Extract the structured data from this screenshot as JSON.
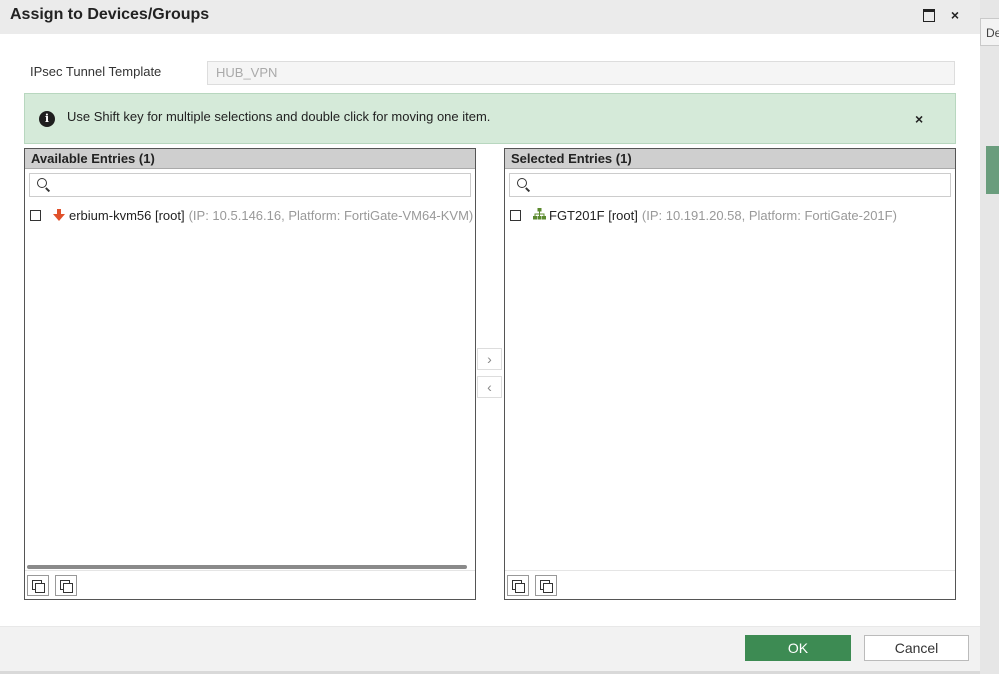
{
  "background": {
    "tab_fragment": "De"
  },
  "dialog": {
    "title": "Assign to Devices/Groups",
    "maximize_icon": "window-maximize",
    "close_glyph": "×"
  },
  "template_field": {
    "label": "IPsec Tunnel Template",
    "value": "HUB_VPN"
  },
  "info_banner": {
    "icon": "info-circle",
    "text": "Use Shift key for multiple selections and double click for moving one item.",
    "close_glyph": "×"
  },
  "available": {
    "header": "Available Entries (1)",
    "search_placeholder": "",
    "entries": [
      {
        "icon": "arrow-down-red",
        "name": "erbium-kvm56 [root]",
        "detail": "(IP: 10.5.146.16, Platform: FortiGate-VM64-KVM)",
        "checked": false
      }
    ]
  },
  "selected": {
    "header": "Selected Entries (1)",
    "search_placeholder": "",
    "entries": [
      {
        "icon": "device-tree-green",
        "name": "FGT201F [root]",
        "detail": "(IP: 10.191.20.58, Platform: FortiGate-201F)",
        "checked": false
      }
    ]
  },
  "move_buttons": {
    "right": "›",
    "left": "‹"
  },
  "buttons": {
    "ok": "OK",
    "cancel": "Cancel"
  },
  "colors": {
    "ok_green": "#3d8b53",
    "info_bg": "#d5ead9",
    "down_arrow": "#e0512b",
    "tree_icon": "#5b8a2e"
  }
}
